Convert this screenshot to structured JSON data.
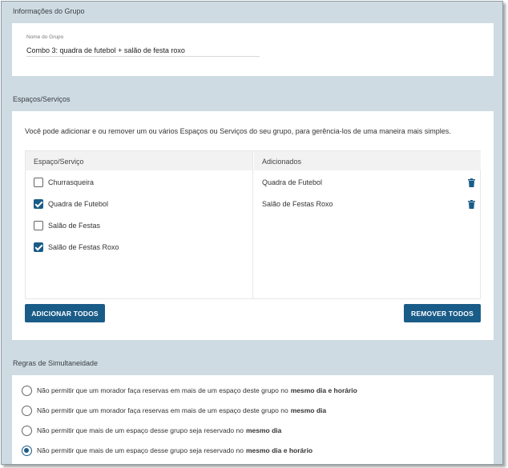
{
  "group_info": {
    "section_title": "Informações do Grupo",
    "name_label": "Nome do Grupo",
    "name_value": "Combo 3: quadra de futebol + salão de festa roxo"
  },
  "spaces": {
    "section_title": "Espaços/Serviços",
    "intro": "Você pode adicionar e ou remover um ou vários Espaços ou Serviços do seu grupo, para gerência-los de uma maneira mais simples.",
    "available_header": "Espaço/Serviço",
    "added_header": "Adicionados",
    "available": [
      {
        "label": "Churrasqueira",
        "checked": false
      },
      {
        "label": "Quadra de Futebol",
        "checked": true
      },
      {
        "label": "Salão de Festas",
        "checked": false
      },
      {
        "label": "Salão de Festas Roxo",
        "checked": true
      }
    ],
    "added": [
      {
        "label": "Quadra de Futebol",
        "icon": "trash-icon"
      },
      {
        "label": "Salão de Festas Roxo",
        "icon": "trash-icon"
      }
    ],
    "add_all_label": "ADICIONAR TODOS",
    "remove_all_label": "REMOVER TODOS"
  },
  "rules": {
    "section_title": "Regras de Simultaneidade",
    "options": [
      {
        "text": "Não permitir que um morador faça reservas em mais de um espaço deste grupo no",
        "bold": "mesmo dia e horário",
        "selected": false
      },
      {
        "text": "Não permitir que um morador faça reservas em mais de um espaço deste grupo no",
        "bold": "mesmo dia",
        "selected": false
      },
      {
        "text": "Não permitir que mais de um espaço desse grupo seja reservado no",
        "bold": "mesmo dia",
        "selected": false
      },
      {
        "text": "Não permitir que mais de um espaço desse grupo seja reservado no",
        "bold": "mesmo dia e horário",
        "selected": true
      }
    ]
  },
  "colors": {
    "accent": "#1a5c88",
    "page_background": "#cfdbe3",
    "card_background": "#ffffff"
  }
}
